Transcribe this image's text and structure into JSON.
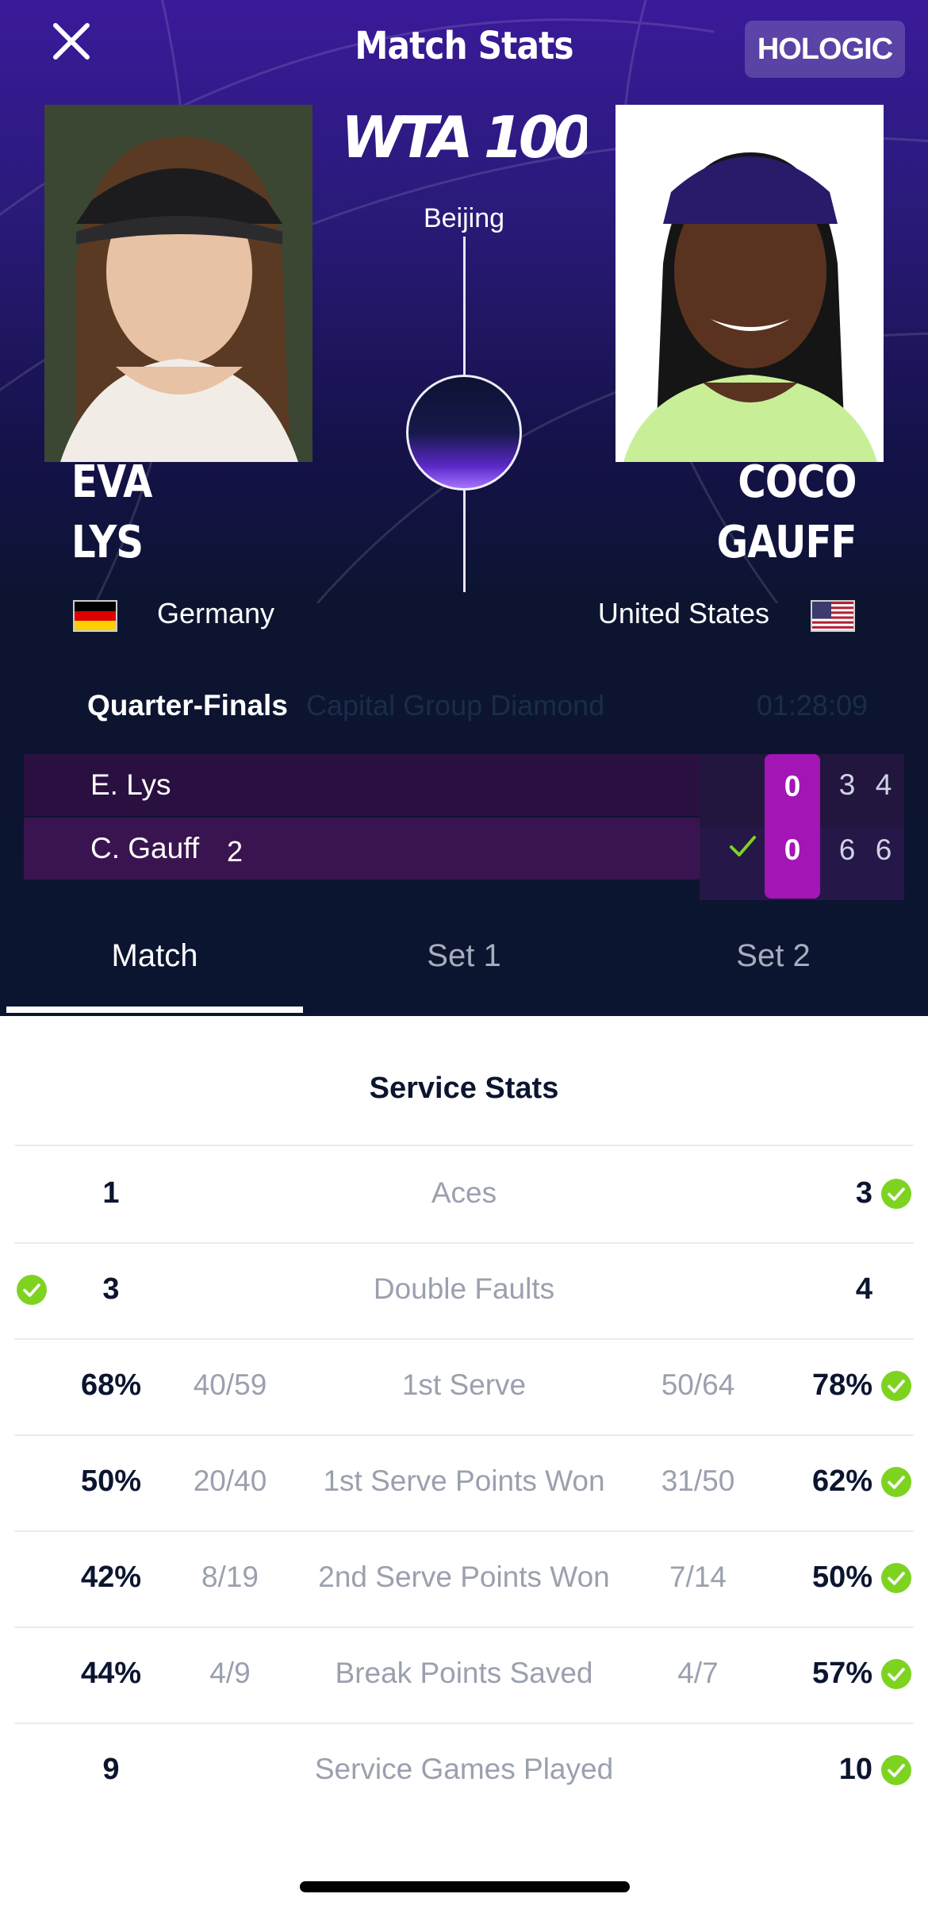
{
  "header": {
    "title": "Match Stats",
    "sponsor": "HOLOGIC",
    "tournament_logo": "WTA 1000",
    "city": "Beijing",
    "close_icon": "close-icon"
  },
  "players": [
    {
      "first": "EVA",
      "last": "LYS",
      "country": "Germany",
      "flag": "germany-flag-icon"
    },
    {
      "first": "COCO",
      "last": "GAUFF",
      "country": "United States",
      "flag": "usa-flag-icon"
    }
  ],
  "match": {
    "round": "Quarter-Finals",
    "sponsor_text": "Capital Group Diamond",
    "duration": "01:28:09"
  },
  "score": {
    "rows": [
      {
        "name": "E. Lys",
        "seed": "",
        "game": "0",
        "sets": [
          "3",
          "4"
        ],
        "winner": false
      },
      {
        "name": "C. Gauff",
        "seed": "2",
        "game": "0",
        "sets": [
          "6",
          "6"
        ],
        "winner": true
      }
    ]
  },
  "tabs": [
    {
      "label": "Match",
      "active": true
    },
    {
      "label": "Set 1",
      "active": false
    },
    {
      "label": "Set 2",
      "active": false
    }
  ],
  "service_stats": {
    "title": "Service Stats",
    "rows": [
      {
        "label": "Aces",
        "left_value": "1",
        "left_fraction": "",
        "right_fraction": "",
        "right_value": "3",
        "leader": "right"
      },
      {
        "label": "Double Faults",
        "left_value": "3",
        "left_fraction": "",
        "right_fraction": "",
        "right_value": "4",
        "leader": "left"
      },
      {
        "label": "1st Serve",
        "left_value": "68%",
        "left_fraction": "40/59",
        "right_fraction": "50/64",
        "right_value": "78%",
        "leader": "right"
      },
      {
        "label": "1st Serve Points Won",
        "left_value": "50%",
        "left_fraction": "20/40",
        "right_fraction": "31/50",
        "right_value": "62%",
        "leader": "right"
      },
      {
        "label": "2nd Serve Points Won",
        "left_value": "42%",
        "left_fraction": "8/19",
        "right_fraction": "7/14",
        "right_value": "50%",
        "leader": "right"
      },
      {
        "label": "Break Points Saved",
        "left_value": "44%",
        "left_fraction": "4/9",
        "right_fraction": "4/7",
        "right_value": "57%",
        "leader": "right"
      },
      {
        "label": "Service Games Played",
        "left_value": "9",
        "left_fraction": "",
        "right_fraction": "",
        "right_value": "10",
        "leader": "right"
      }
    ]
  },
  "colors": {
    "accent_purple": "#a315b5",
    "win_green": "#7ed321",
    "navy": "#0b1530"
  }
}
